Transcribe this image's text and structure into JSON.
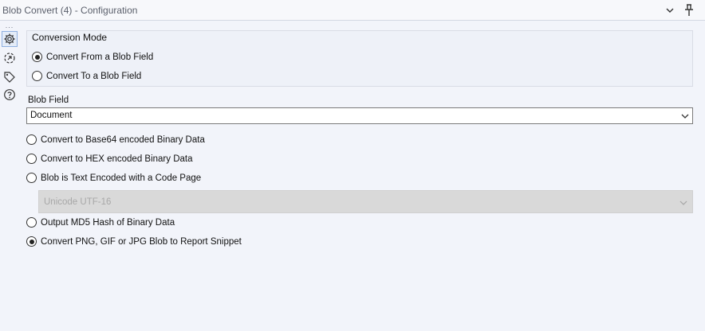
{
  "window": {
    "title": "Blob Convert (4) - Configuration",
    "collapse_icon": "chevron-down-icon",
    "pin_icon": "pin-icon"
  },
  "sidebar": {
    "dots": "...",
    "icons": [
      "gear-icon",
      "connection-icon",
      "tag-icon",
      "help-icon"
    ]
  },
  "conversion_mode": {
    "title": "Conversion Mode",
    "options": [
      {
        "label": "Convert From a Blob Field",
        "checked": true
      },
      {
        "label": "Convert To a Blob Field",
        "checked": false
      }
    ]
  },
  "blob_field": {
    "label": "Blob Field",
    "value": "Document"
  },
  "options": [
    {
      "label": "Convert to Base64 encoded Binary Data",
      "checked": false
    },
    {
      "label": "Convert to HEX encoded Binary Data",
      "checked": false
    },
    {
      "label": "Blob is Text Encoded with a Code Page",
      "checked": false
    },
    {
      "label": "Output MD5 Hash of Binary Data",
      "checked": false
    },
    {
      "label": "Convert PNG, GIF or JPG Blob to Report Snippet",
      "checked": true
    }
  ],
  "code_page": {
    "value": "Unicode UTF-16",
    "disabled": true
  },
  "colors": {
    "background": "#f2f4fa",
    "active_icon_border": "#8fb0e0",
    "disabled_select": "#d9d9d9"
  }
}
